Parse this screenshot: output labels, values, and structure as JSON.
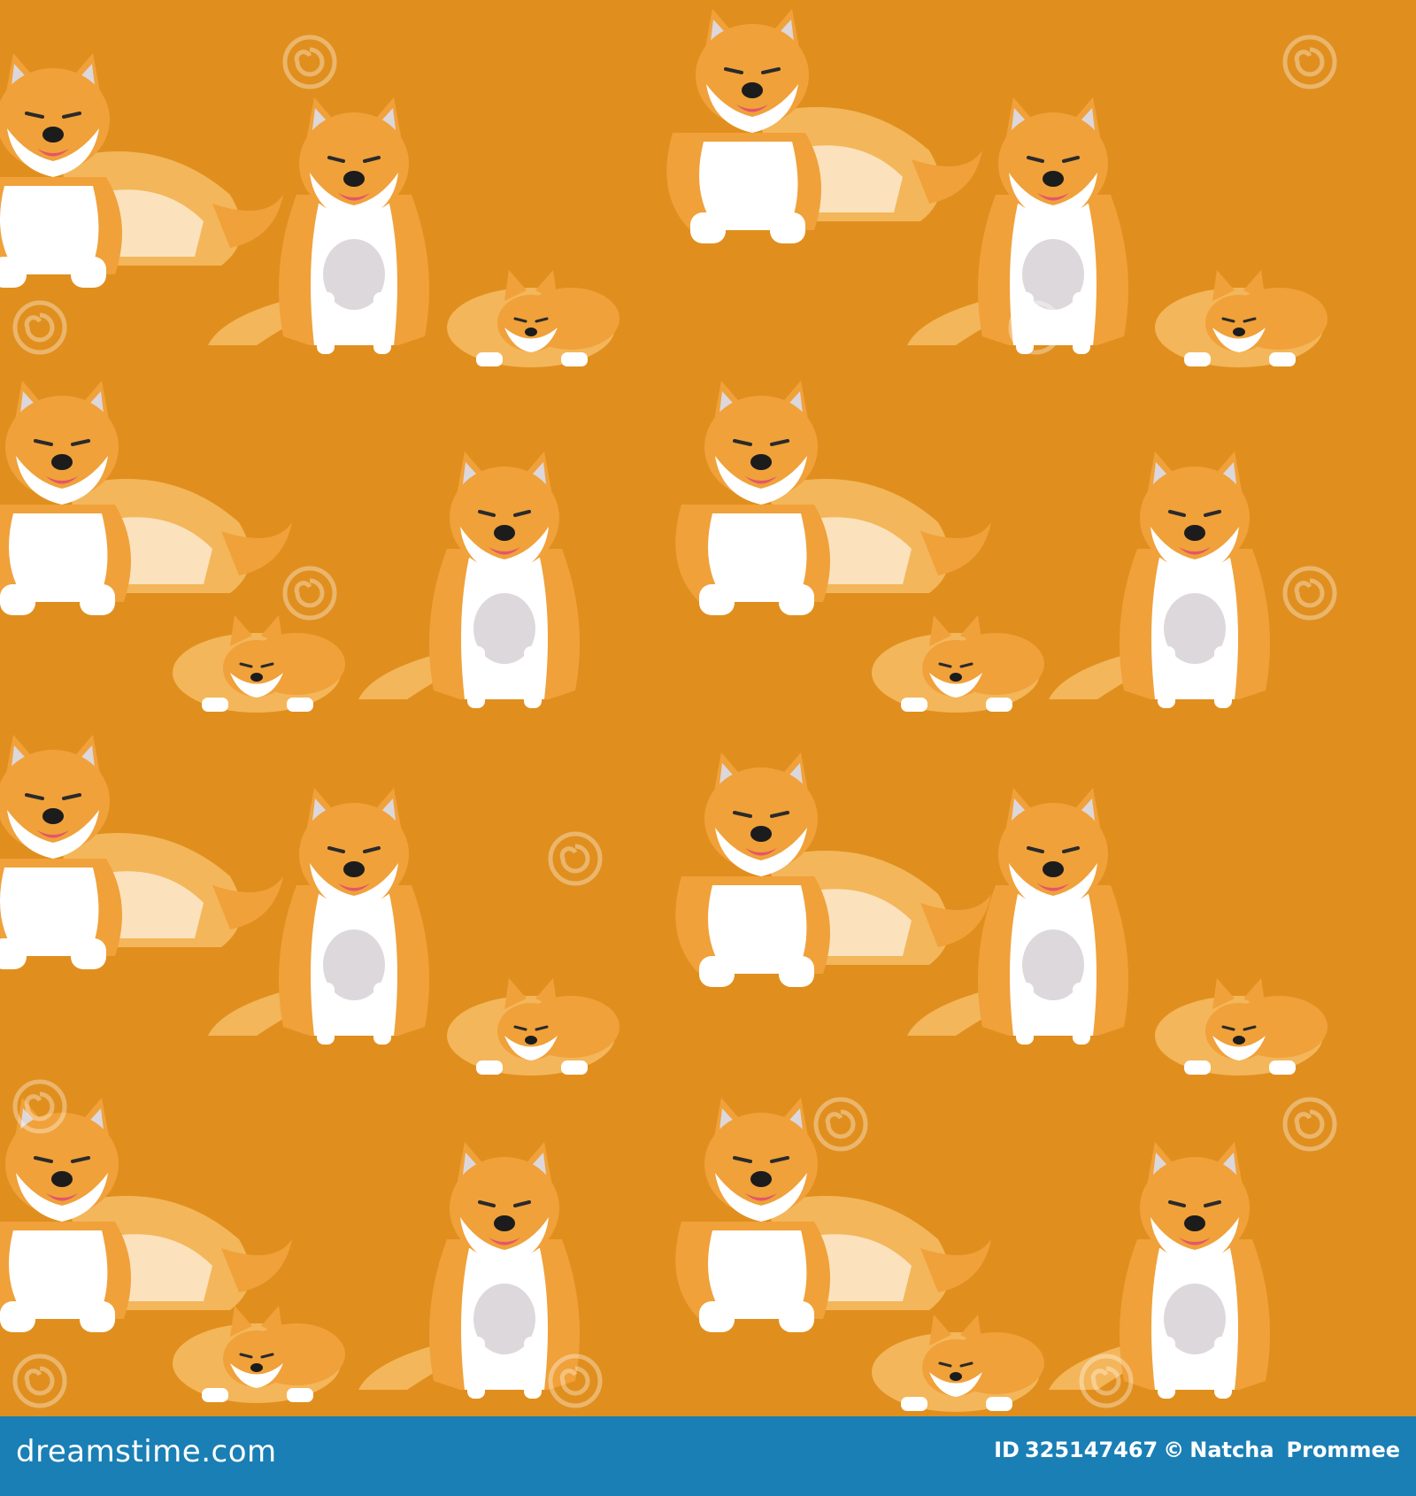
{
  "image": {
    "background_color": "#e08f1e",
    "subject": "shiba-inu-dogs",
    "poses": [
      "sitting",
      "lying",
      "sleeping"
    ],
    "fur_color": "#f0a13a",
    "fur_light_color": "#f7c569",
    "fur_white_color": "#ffffff",
    "watermark_text": "dreamstime"
  },
  "footer": {
    "background_color": "#1a7fb5",
    "site_name": "dreamstime.com",
    "id_label": "ID",
    "id_number": "325147467",
    "copyright_symbol": "©",
    "author_first": "Natcha",
    "author_last": "Prommee"
  }
}
